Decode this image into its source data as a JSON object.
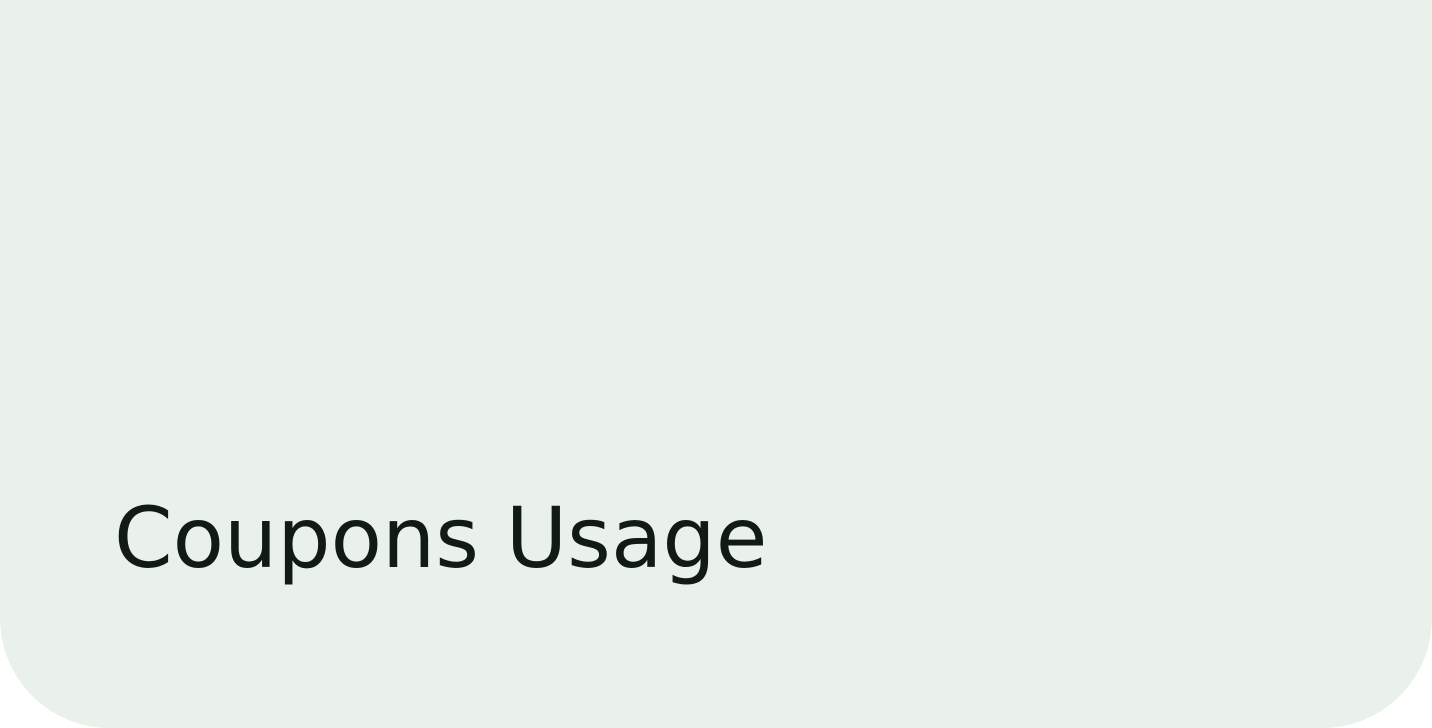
{
  "card": {
    "title": "Coupons Usage",
    "background_color": "#e9f1ea",
    "text_color": "#121a15"
  }
}
